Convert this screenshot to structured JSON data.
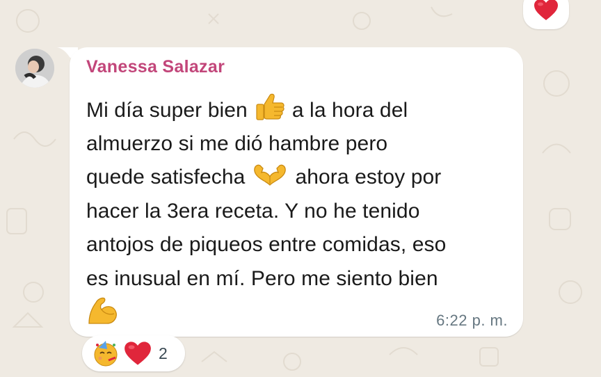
{
  "message": {
    "sender_name": "Vanessa Salazar",
    "lines": [
      [
        "Mi día super bien",
        "a la hora del"
      ],
      [
        "almuerzo si me dió hambre pero"
      ],
      [
        "quede satisfecha",
        "ahora estoy por"
      ],
      [
        "hacer la 3era receta. Y no he tenido"
      ],
      [
        "antojos de piqueos entre comidas, eso"
      ],
      [
        "es inusual en mí. Pero me siento bien"
      ]
    ],
    "timestamp": "6:22 p. m.",
    "emoji_icons": [
      "thumbs-up-icon",
      "heart-hands-icon",
      "flexed-biceps-icon"
    ]
  },
  "reactions": {
    "top_reaction_icon": "red-heart-icon",
    "pill_icons": [
      "partying-face-icon",
      "red-heart-icon"
    ],
    "count": "2"
  },
  "colors": {
    "background": "#efeae2",
    "bubble": "#ffffff",
    "sender_name": "#c2467a",
    "timestamp": "#667781",
    "heart": "#e0263b",
    "emoji_yellow": "#f5b82e"
  }
}
